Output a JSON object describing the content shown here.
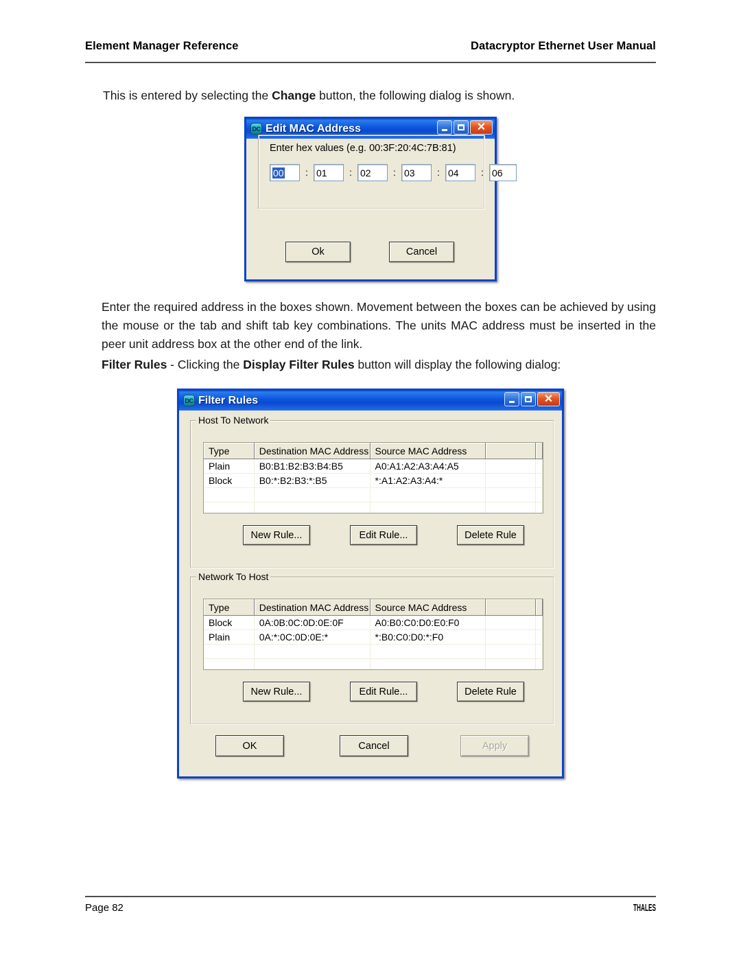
{
  "page": {
    "header_left": "Element Manager Reference",
    "header_right": "Datacryptor Ethernet User Manual",
    "footer_left": "Page 82",
    "footer_right": "THALES"
  },
  "paragraphs": {
    "intro_before": "This is entered by selecting the ",
    "intro_bold": "Change",
    "intro_after": " button, the following dialog is shown.",
    "middle": "Enter the required address in the boxes shown. Movement between the boxes can be achieved by using the mouse or the tab and shift tab key combinations. The units MAC address must be inserted in the peer unit address box at the other end of the link.",
    "filter_bold_lead": "Filter Rules",
    "filter_mid": " - Clicking the ",
    "filter_bold_two": "Display Filter Rules",
    "filter_tail": " button will display the following dialog:"
  },
  "edit_mac_dialog": {
    "title": "Edit MAC Address",
    "icon_label": "DC",
    "hint": "Enter hex values (e.g. 00:3F:20:4C:7B:81)",
    "separator": ":",
    "fields": [
      {
        "value": "00",
        "selected": true
      },
      {
        "value": "01",
        "selected": false
      },
      {
        "value": "02",
        "selected": false
      },
      {
        "value": "03",
        "selected": false
      },
      {
        "value": "04",
        "selected": false
      },
      {
        "value": "06",
        "selected": false
      }
    ],
    "ok_label": "Ok",
    "cancel_label": "Cancel",
    "titlebar_buttons": {
      "minimize": "minimize-icon",
      "maximize": "maximize-icon",
      "close": "close-icon"
    }
  },
  "filter_rules_dialog": {
    "title": "Filter Rules",
    "icon_label": "DC",
    "columns": [
      "Type",
      "Destination MAC Address",
      "Source MAC Address",
      ""
    ],
    "host_to_network": {
      "group_label": "Host To Network",
      "rows": [
        [
          "Plain",
          "B0:B1:B2:B3:B4:B5",
          "A0:A1:A2:A3:A4:A5",
          ""
        ],
        [
          "Block",
          "B0:*:B2:B3:*:B5",
          "*:A1:A2:A3:A4:*",
          ""
        ],
        [
          "",
          "",
          "",
          ""
        ],
        [
          "",
          "",
          "",
          ""
        ]
      ],
      "new_rule_label": "New Rule...",
      "edit_rule_label": "Edit Rule...",
      "delete_rule_label": "Delete Rule"
    },
    "network_to_host": {
      "group_label": "Network To Host",
      "rows": [
        [
          "Block",
          "0A:0B:0C:0D:0E:0F",
          "A0:B0:C0:D0:E0:F0",
          ""
        ],
        [
          "Plain",
          "0A:*:0C:0D:0E:*",
          "*:B0:C0:D0:*:F0",
          ""
        ],
        [
          "",
          "",
          "",
          ""
        ],
        [
          "",
          "",
          "",
          ""
        ]
      ],
      "new_rule_label": "New Rule...",
      "edit_rule_label": "Edit Rule...",
      "delete_rule_label": "Delete Rule"
    },
    "ok_label": "OK",
    "cancel_label": "Cancel",
    "apply_label": "Apply",
    "apply_disabled": true
  },
  "colors": {
    "titlebar_blue": "#0a49cf",
    "window_face": "#ece9d8",
    "close_button": "#e4551f",
    "selection_blue": "#2a5fc8",
    "rule_line": "#4d4d4d"
  }
}
